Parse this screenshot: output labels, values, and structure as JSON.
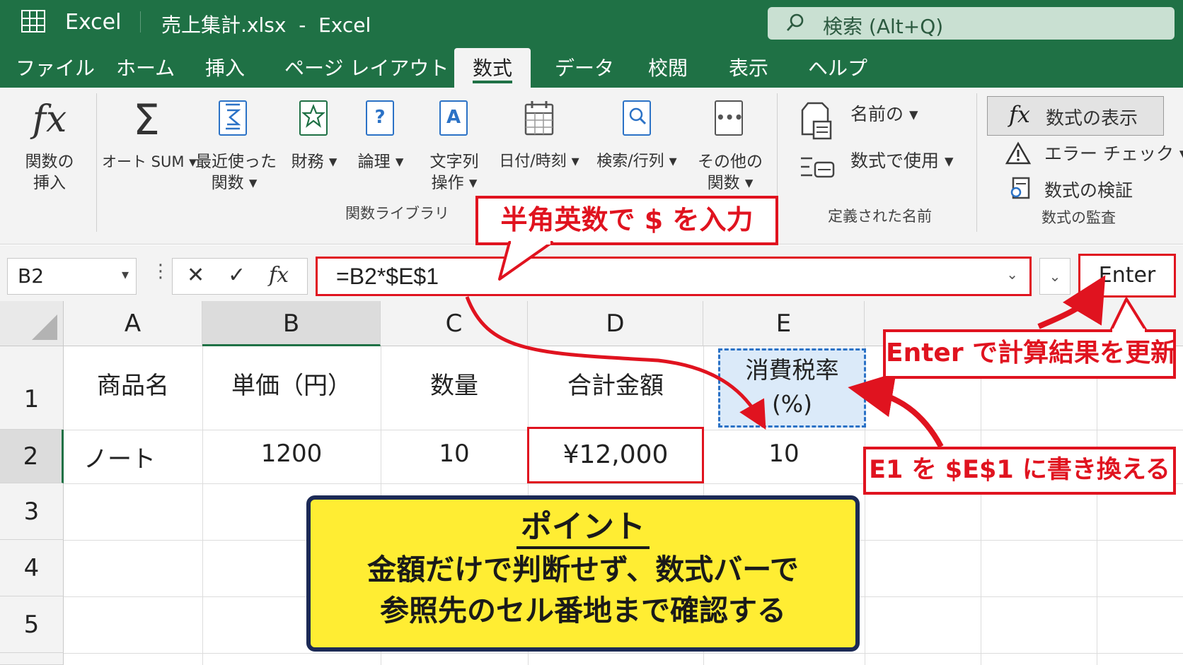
{
  "window": {
    "app_name": "Excel",
    "file_title": "売上集計.xlsx  -  Excel",
    "search_placeholder": "検索 (Alt+Q)"
  },
  "tabs": [
    "ファイル",
    "ホーム",
    "挿入",
    "ページ レイアウト",
    "数式",
    "データ",
    "校閲",
    "表示",
    "ヘルプ"
  ],
  "active_tab": "数式",
  "ribbon": {
    "insert_function": {
      "icon": "fx",
      "line1": "関数の",
      "line2": "挿入"
    },
    "autosum": {
      "icon": "Σ",
      "label": "オート SUM ▾"
    },
    "recent": {
      "line1": "最近使った",
      "line2": "関数 ▾"
    },
    "financial": {
      "label": "財務 ▾"
    },
    "logical": {
      "icon": "?",
      "label": "論理 ▾"
    },
    "text": {
      "icon": "A",
      "line1": "文字列",
      "line2": "操作 ▾"
    },
    "datetime": {
      "label": "日付/時刻 ▾"
    },
    "lookup": {
      "label": "検索/行列 ▾"
    },
    "other": {
      "icon": "•••",
      "line1": "その他の",
      "line2": "関数 ▾"
    },
    "function_library_label": "関数ライブラリ",
    "name_manager": "名前の ▾",
    "use_in_formula": "数式で使用 ▾",
    "defined_names_label": "定義された名前",
    "show_formulas": "数式の表示",
    "error_checking": "エラー チェック ▾",
    "evaluate_formula": "数式の検証",
    "formula_auditing_label": "数式の監査"
  },
  "formula_bar": {
    "name_box": "B2",
    "name_box_arrow": "▾",
    "more_dots": "⋮",
    "cancel": "✕",
    "confirm": "✓",
    "fx": "fx",
    "formula": "=B2*$E$1",
    "expand": "⌄",
    "enter_key": "Enter"
  },
  "sheet": {
    "columns": [
      "A",
      "B",
      "C",
      "D",
      "E"
    ],
    "rows": [
      "1",
      "2",
      "3",
      "4",
      "5"
    ],
    "headers": [
      "商品名",
      "単価（円）",
      "数量",
      "合計金額"
    ],
    "e1_line1": "消費税率",
    "e1_line2": "(%)",
    "row2": [
      "ノート",
      "1200",
      "10",
      "¥12,000",
      "10"
    ]
  },
  "callouts": {
    "dollar": "半角英数で $ を入力",
    "enter": "Enter で計算結果を更新",
    "replace": "E1 を $E$1 に書き換える"
  },
  "point": {
    "title": "ポイント",
    "line1": "金額だけで判断せず、数式バーで",
    "line2": "参照先のセル番地まで確認する"
  },
  "colors": {
    "excel_green": "#1f7145",
    "callout_red": "#e0131f",
    "highlight_blue": "#2b72c6",
    "point_yellow": "#ffed33",
    "point_border": "#1c2a55"
  }
}
